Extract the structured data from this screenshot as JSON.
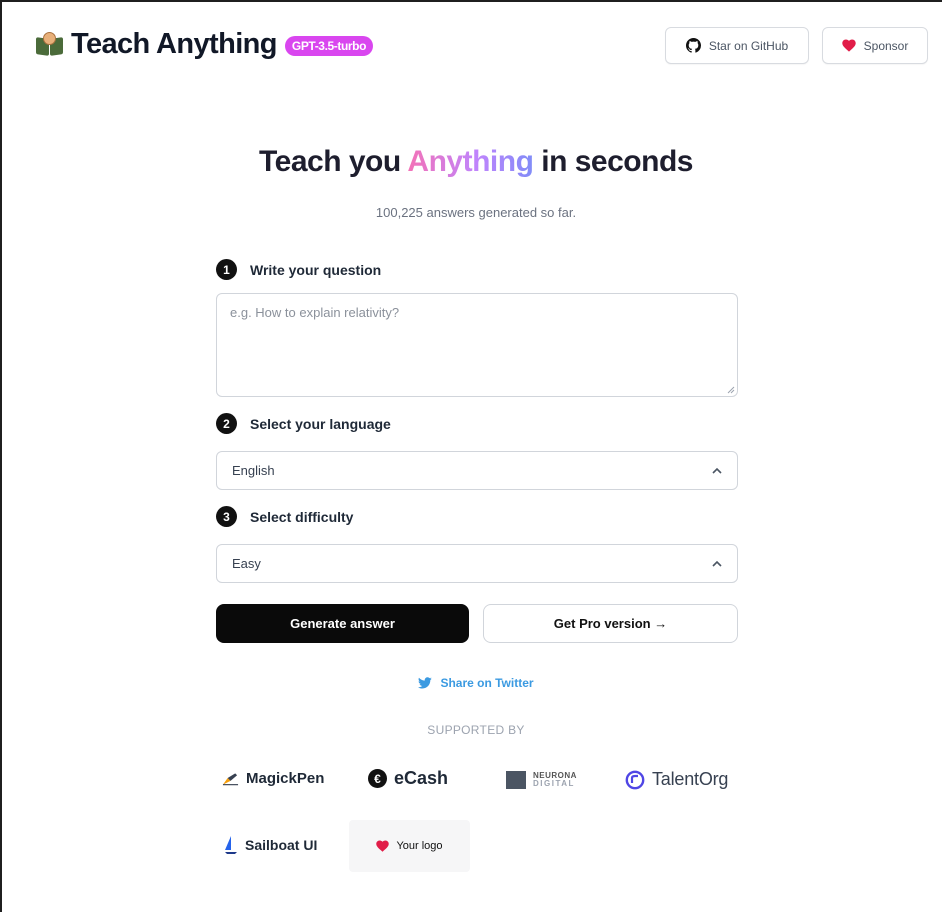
{
  "header": {
    "brand": "Teach Anything",
    "model_badge": "GPT-3.5-turbo",
    "github_button": "Star on GitHub",
    "sponsor_button": "Sponsor"
  },
  "hero": {
    "title_before": "Teach you ",
    "title_highlight": "Anything",
    "title_after": " in seconds",
    "counter": "100,225 answers generated so far."
  },
  "form": {
    "step1": {
      "number": "1",
      "label": "Write your question"
    },
    "question": {
      "placeholder": "e.g. How to explain relativity?",
      "value": ""
    },
    "step2": {
      "number": "2",
      "label": "Select your language"
    },
    "language": {
      "selected": "English"
    },
    "step3": {
      "number": "3",
      "label": "Select difficulty"
    },
    "difficulty": {
      "selected": "Easy"
    },
    "generate_button": "Generate answer",
    "pro_button": "Get Pro version →"
  },
  "share": {
    "label": "Share on Twitter"
  },
  "supported": {
    "heading": "SUPPORTED BY",
    "sponsors": {
      "magickpen": "MagickPen",
      "ecash": "eCash",
      "neurona_line1": "NEURONA",
      "neurona_line2": "DIGITAL",
      "talentorg": "TalentOrg",
      "sailboat": "Sailboat UI",
      "your_logo": "Your logo"
    }
  },
  "colors": {
    "badge": "#d946ef",
    "highlight_gradient": [
      "#f472b6",
      "#c084fc",
      "#818cf8"
    ],
    "twitter": "#3b9ae1",
    "primary_button": "#0a0a0a"
  },
  "icons": [
    "book-emoji-icon",
    "github-icon",
    "heart-icon",
    "chevron-up-icon",
    "twitter-icon",
    "pen-icon",
    "ecash-icon",
    "neurona-icon",
    "talentorg-icon",
    "sailboat-icon"
  ]
}
